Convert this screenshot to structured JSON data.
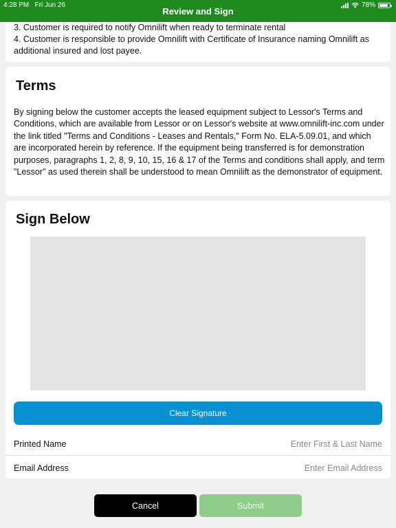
{
  "status_bar": {
    "time": "4:28 PM",
    "date": "Fri Jun 26",
    "battery": "78%"
  },
  "header": {
    "title": "Review and Sign",
    "color": "#1f8b1f"
  },
  "rental_conditions": {
    "items": [
      "3. Customer is required to notify Omnilift when ready to terminate rental",
      "4. Customer is responsible to provide Omnilift with Certificate of Insurance naming Omnilift as additional insured and lost payee."
    ]
  },
  "terms": {
    "title": "Terms",
    "body": "By signing below the customer accepts the leased equipment subject to Lessor's Terms and Conditions, which are available from Lessor or on Lessor's website at www.omnilift-inc.com under the link titled \"Terms and Conditions - Leases and Rentals,\" Form No. ELA-5.09.01, and which are incorporated herein by reference. If the equipment being transferred is for demonstration purposes, paragraphs 1, 2, 8, 9, 10, 15, 16 & 17 of the Terms and conditions shall apply, and term \"Lessor\" as used therein shall be understood to mean Omnilift as the demonstrator of equipment."
  },
  "sign": {
    "title": "Sign Below",
    "clear_label": "Clear Signature",
    "printed_name_label": "Printed Name",
    "printed_name_placeholder": "Enter First & Last Name",
    "printed_name_value": "",
    "email_label": "Email Address",
    "email_placeholder": "Enter Email Address",
    "email_value": ""
  },
  "actions": {
    "cancel_label": "Cancel",
    "submit_label": "Submit"
  },
  "colors": {
    "clear_button": "#0891d1",
    "submit_disabled": "#8fcc8a"
  }
}
